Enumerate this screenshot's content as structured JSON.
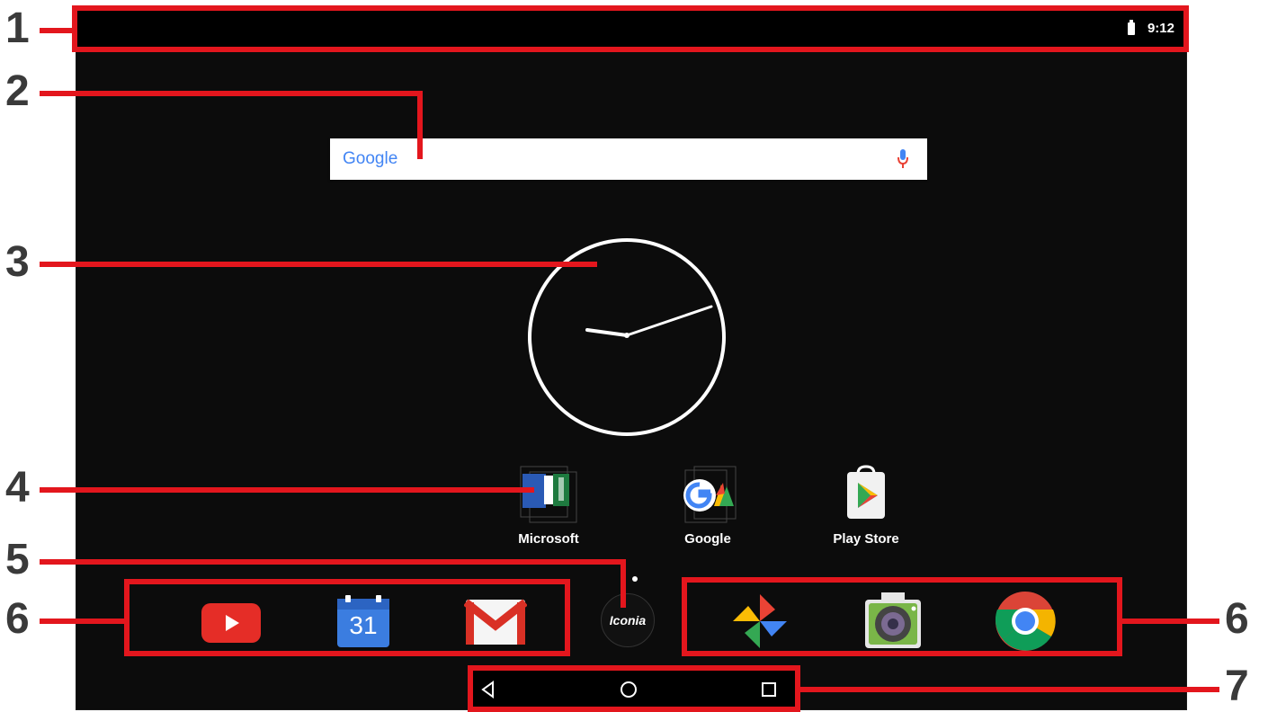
{
  "status_bar": {
    "time": "9:12",
    "icons": [
      "battery-icon"
    ]
  },
  "search_bar": {
    "logo": "Google",
    "icons": [
      "mic-icon"
    ]
  },
  "clock_widget": {
    "style": "analog",
    "icons": [
      "analog-clock"
    ]
  },
  "home_apps": [
    {
      "label": "Microsoft",
      "icon": "microsoft-folder-icon"
    },
    {
      "label": "Google",
      "icon": "google-folder-icon"
    },
    {
      "label": "Play Store",
      "icon": "play-store-icon"
    }
  ],
  "dock_left": [
    {
      "icon": "youtube-icon"
    },
    {
      "icon": "calendar-icon",
      "text": "31"
    },
    {
      "icon": "gmail-icon"
    }
  ],
  "dock_right": [
    {
      "icon": "photos-icon"
    },
    {
      "icon": "camera-icon"
    },
    {
      "icon": "chrome-icon"
    }
  ],
  "launcher": {
    "label": "Iconia"
  },
  "navigation": {
    "buttons": [
      "back-icon",
      "home-icon",
      "recents-icon"
    ]
  },
  "callouts": [
    "1",
    "2",
    "3",
    "4",
    "5",
    "6",
    "6",
    "7"
  ],
  "colors": {
    "callout": "#e3161d",
    "callout_text": "#3a3a3a",
    "background": "#0c0c0c"
  }
}
